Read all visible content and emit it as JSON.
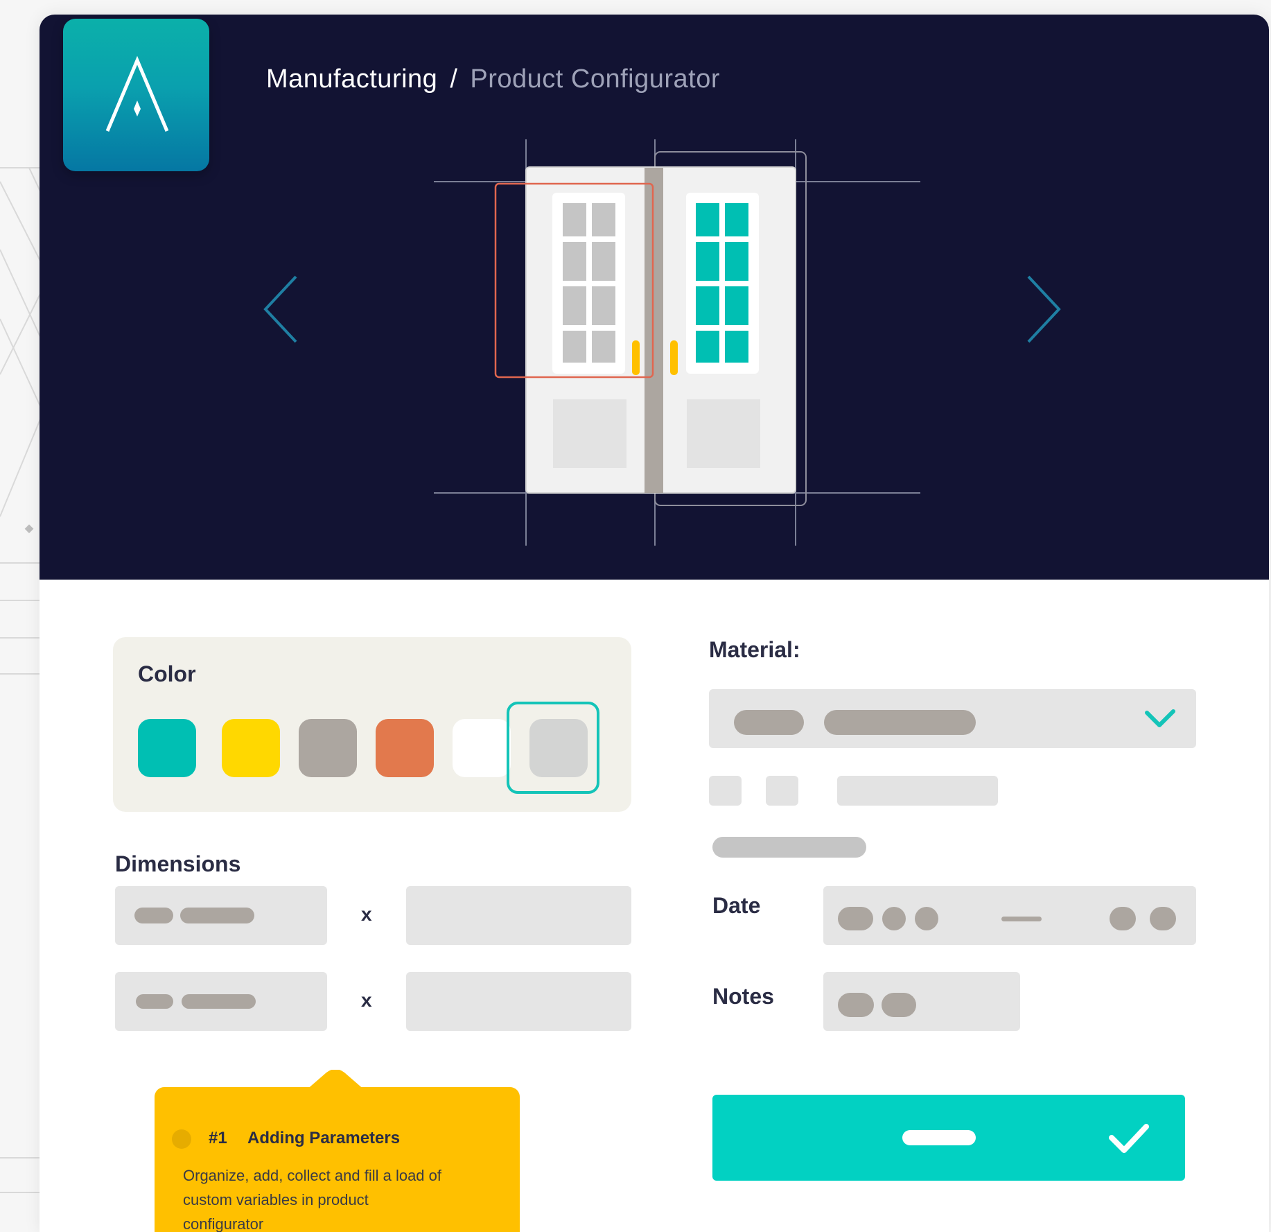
{
  "breadcrumb": {
    "root": "Manufacturing",
    "separator": "/",
    "current": "Product Configurator"
  },
  "logo": {
    "icon": "a-logo-icon"
  },
  "navigation": {
    "prev_icon": "chevron-left-icon",
    "next_icon": "chevron-right-icon"
  },
  "color": {
    "label": "Color",
    "swatches": [
      "#00bfb3",
      "#ffd800",
      "#aca6a0",
      "#e2794d",
      "#ffffff",
      "#d3d4d3"
    ],
    "selected_index": 5
  },
  "dimensions": {
    "label": "Dimensions",
    "separator": "x"
  },
  "material": {
    "label": "Material:",
    "dropdown_icon": "chevron-down-icon"
  },
  "date": {
    "label": "Date"
  },
  "notes": {
    "label": "Notes"
  },
  "submit": {
    "icon": "check-icon"
  },
  "tooltip": {
    "number": "#1",
    "title": "Adding Parameters",
    "text": "Organize, add, collect and fill a load of\ncustom variables   in product\nconfigurator"
  },
  "colors": {
    "hero_bg": "#121333",
    "accent": "#02d1c2",
    "tooltip": "#ffc000",
    "selection_box": "#e0664f",
    "handle": "#ffc000"
  }
}
